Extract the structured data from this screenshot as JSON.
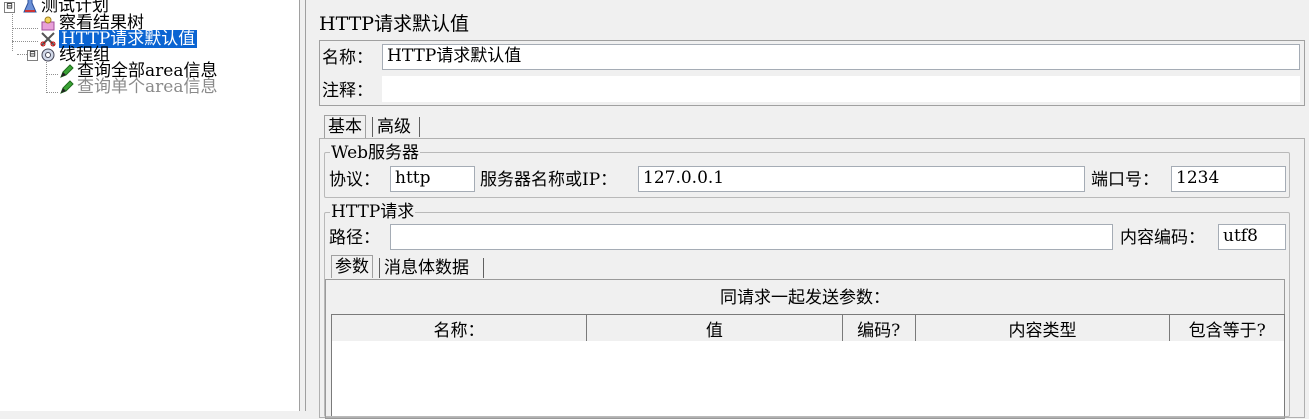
{
  "tree": {
    "nodes": [
      {
        "label": "测试计划",
        "icon": "test-plan-icon",
        "toggle": "⊟"
      },
      {
        "label": "察看结果树",
        "icon": "results-tree-icon"
      },
      {
        "label": "HTTP请求默认值",
        "icon": "config-scissors-icon",
        "selected": true
      },
      {
        "label": "线程组",
        "icon": "thread-group-gear-icon",
        "toggle": "⊟"
      },
      {
        "label": "查询全部area信息",
        "icon": "sampler-pen-icon"
      },
      {
        "label": "查询单个area信息",
        "icon": "sampler-pen-icon",
        "disabled": true
      }
    ]
  },
  "panel": {
    "title": "HTTP请求默认值",
    "name_label": "名称：",
    "name_value": "HTTP请求默认值",
    "comment_label": "注释：",
    "comment_value": "",
    "tabs": [
      "基本",
      "高级"
    ],
    "web_server": {
      "legend": "Web服务器",
      "protocol_label": "协议：",
      "protocol_value": "http",
      "server_label": "服务器名称或IP：",
      "server_value": "127.0.0.1",
      "port_label": "端口号：",
      "port_value": "1234"
    },
    "http_request": {
      "legend": "HTTP请求",
      "path_label": "路径：",
      "path_value": "",
      "encoding_label": "内容编码：",
      "encoding_value": "utf8",
      "subtabs": [
        "参数",
        "消息体数据"
      ],
      "params_caption": "同请求一起发送参数：",
      "columns": [
        "名称：",
        "值",
        "编码?",
        "内容类型",
        "包含等于?"
      ]
    }
  }
}
